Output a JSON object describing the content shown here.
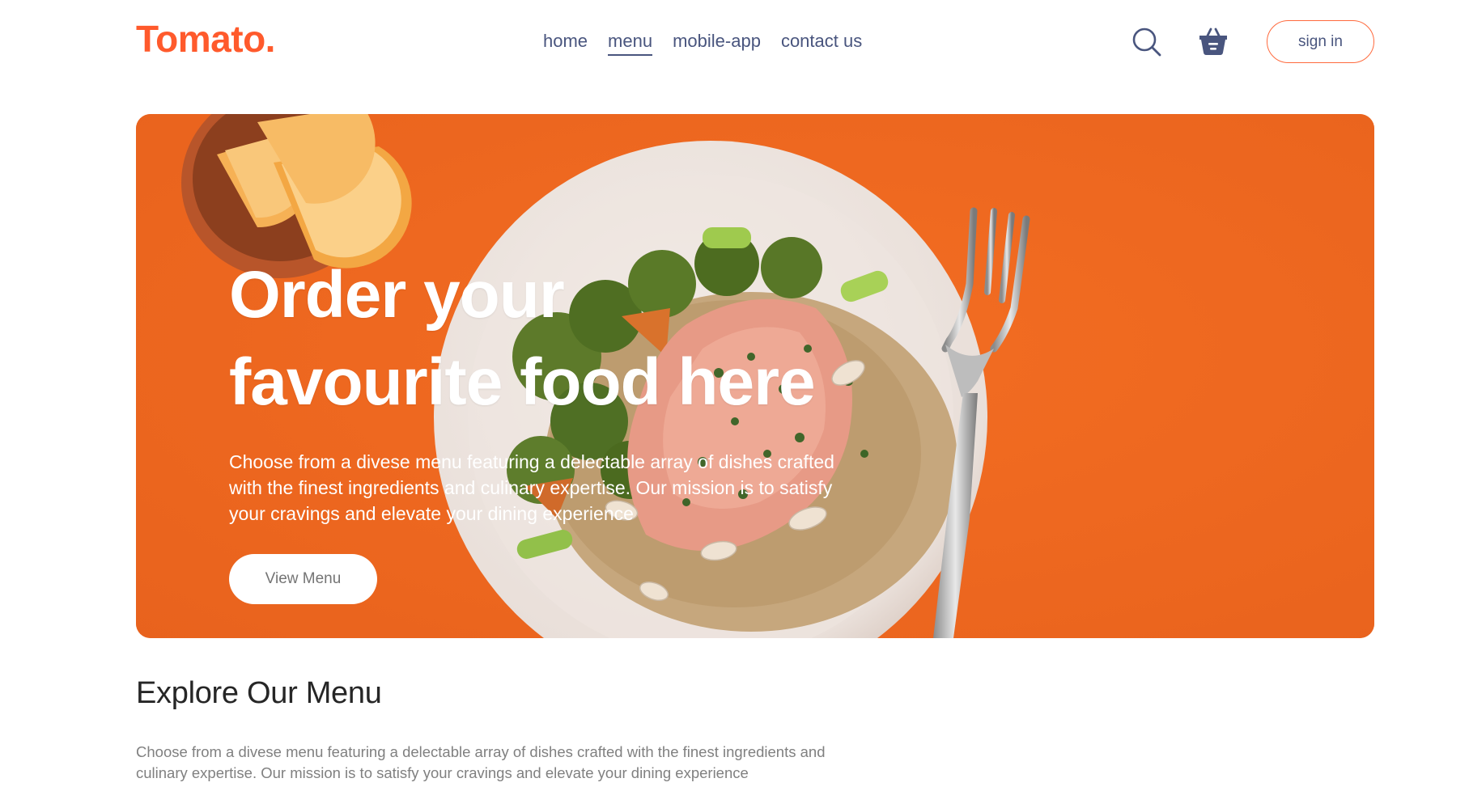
{
  "brand": {
    "logo_text": "Tomato.",
    "accent_color": "#ff5a2c",
    "nav_text_color": "#49557e"
  },
  "navbar": {
    "menu": [
      {
        "label": "home",
        "active": false
      },
      {
        "label": "menu",
        "active": true
      },
      {
        "label": "mobile-app",
        "active": false
      },
      {
        "label": "contact us",
        "active": false
      }
    ],
    "search_icon": "search-icon",
    "basket_icon": "basket-icon",
    "sign_in_label": "sign in"
  },
  "hero": {
    "title_line1": "Order your",
    "title_line2": "favourite food here",
    "description": "Choose from a divese menu featuring a delectable array of dishes crafted with the finest ingredients and culinary expertise. Our mission is to satisfy your cravings and elevate your dining experience",
    "button_label": "View Menu",
    "background_color": "#ef6a24"
  },
  "explore": {
    "title": "Explore Our Menu",
    "text": "Choose from a divese menu featuring a delectable array of dishes crafted with the finest ingredients and culinary expertise. Our mission is to satisfy your cravings and elevate your dining experience"
  }
}
